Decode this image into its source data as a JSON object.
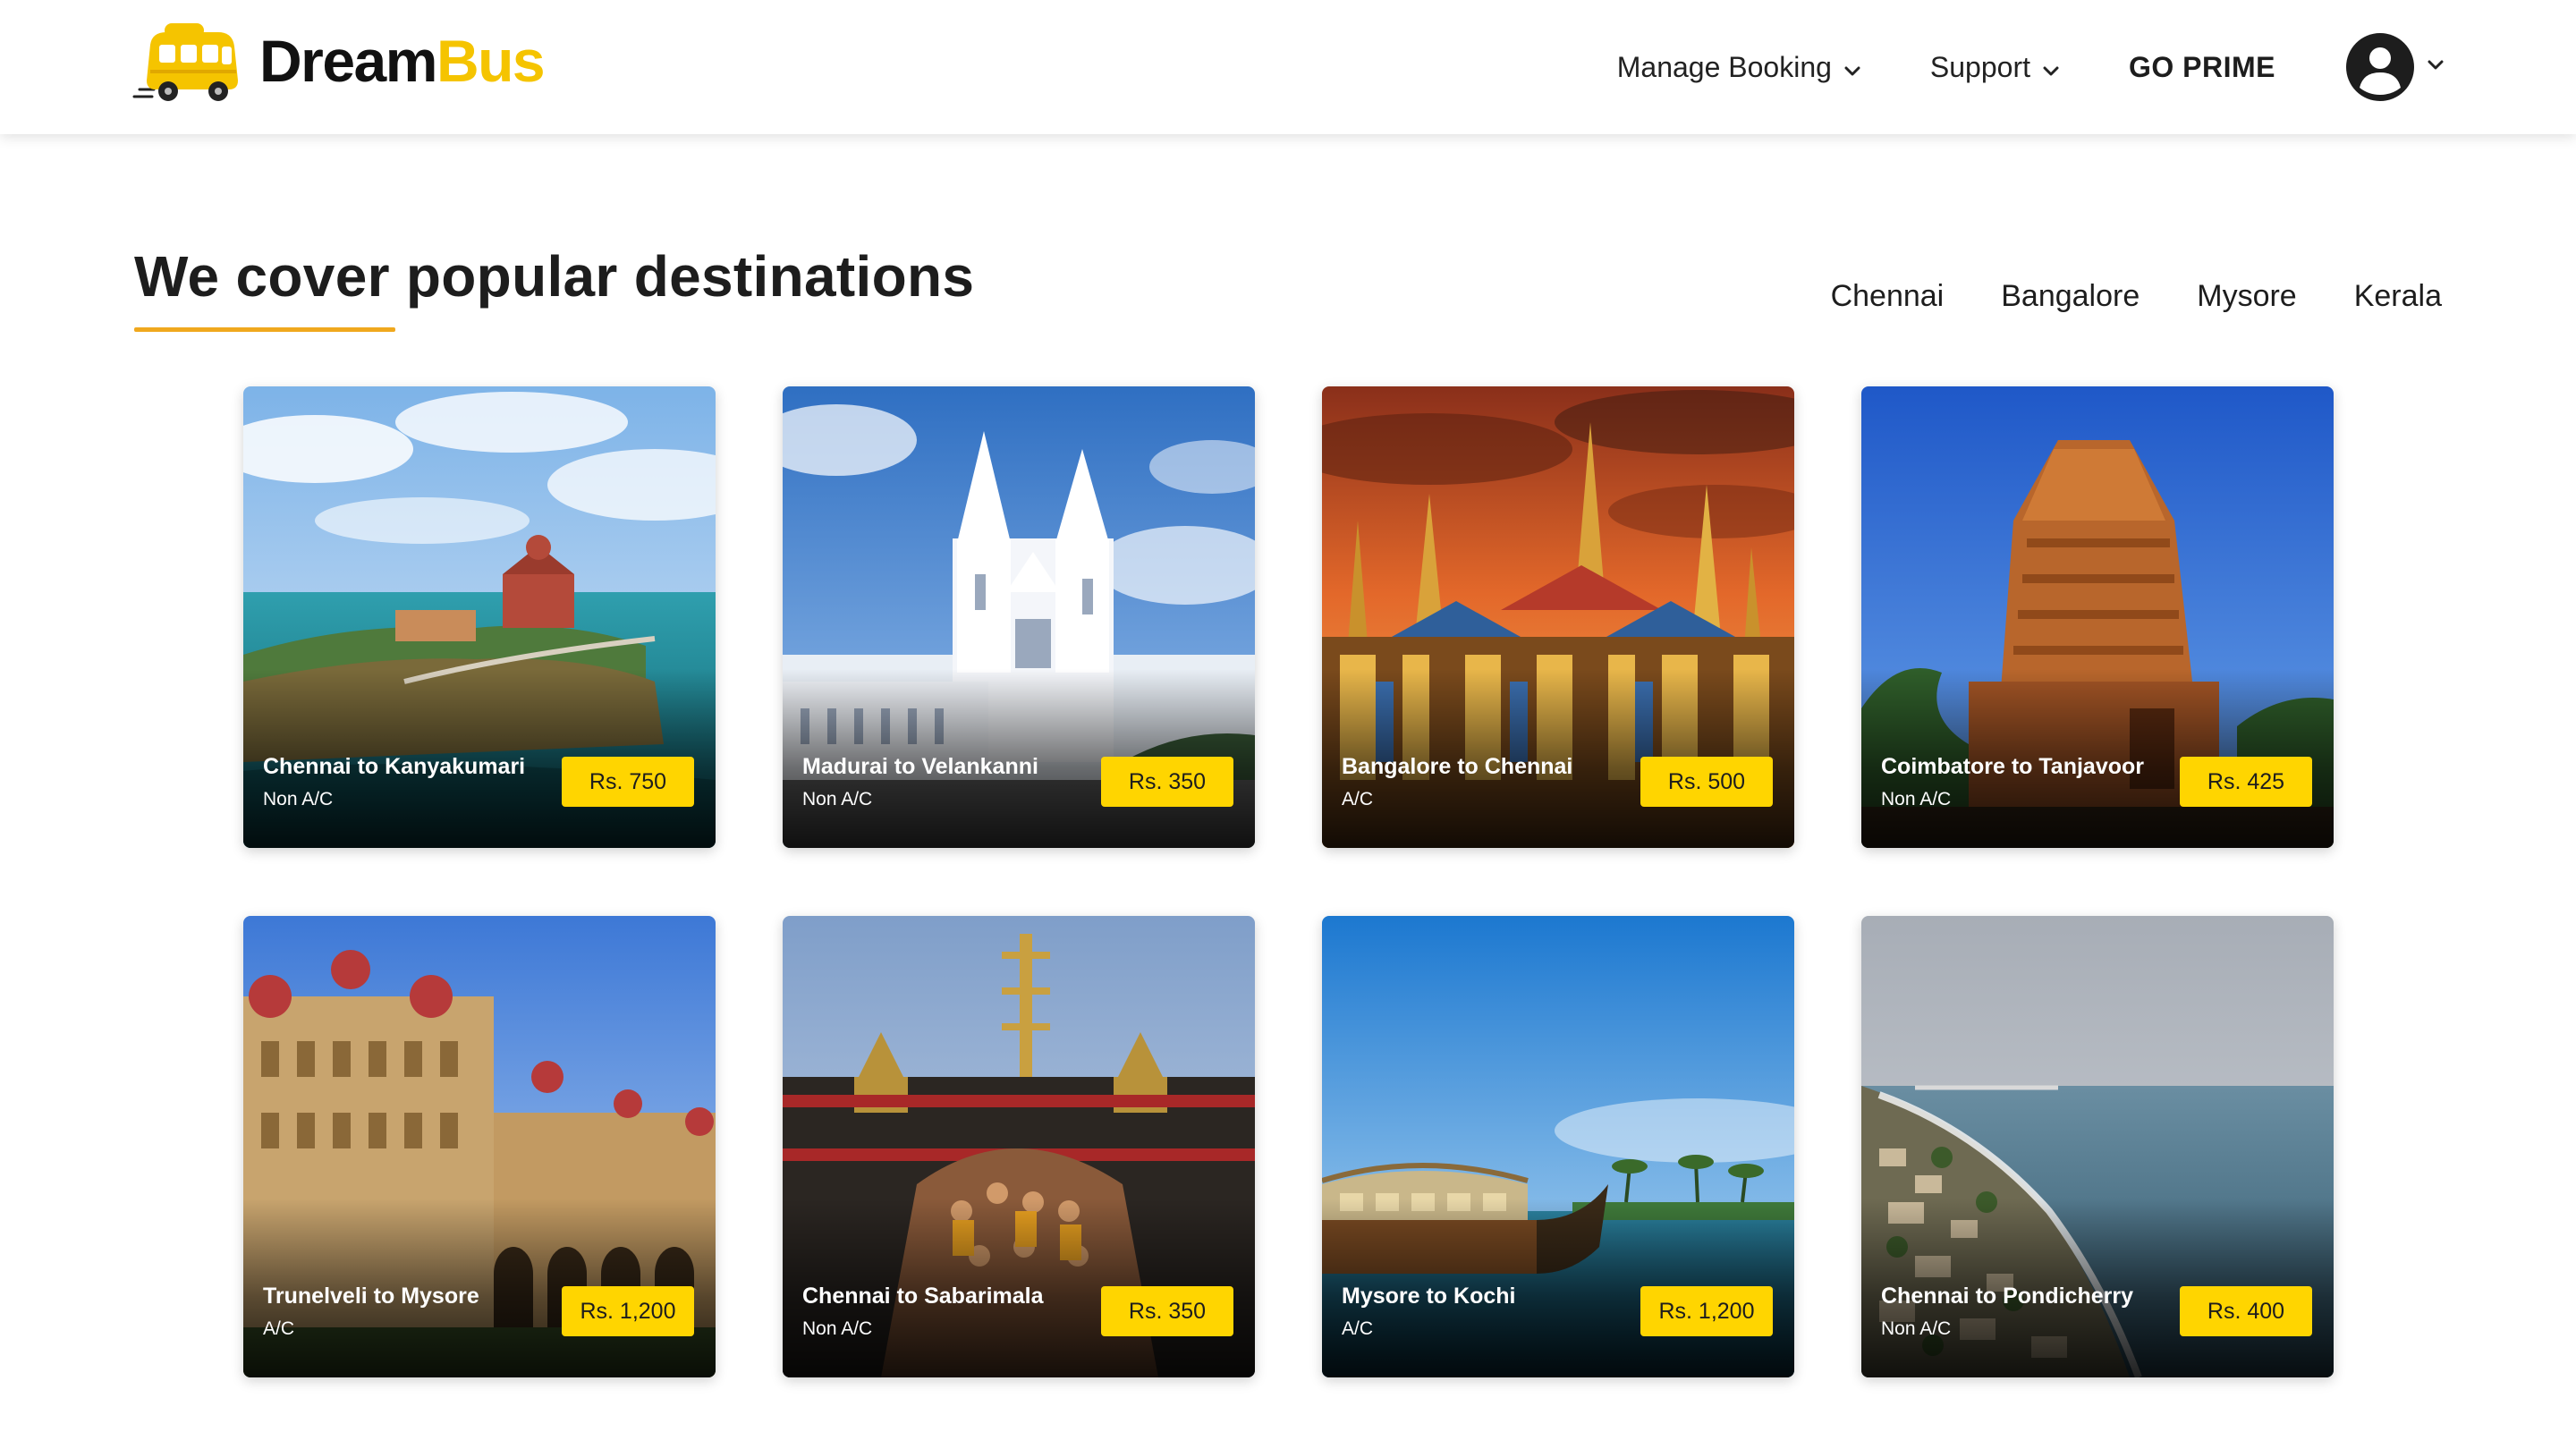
{
  "header": {
    "logo_dream": "Dream",
    "logo_bus": "Bus",
    "nav": {
      "manage_booking": "Manage Booking",
      "support": "Support",
      "go_prime": "GO PRIME"
    }
  },
  "section": {
    "title": "We cover popular destinations",
    "city_tabs": [
      "Chennai",
      "Bangalore",
      "Mysore",
      "Kerala"
    ]
  },
  "cards": [
    {
      "route": "Chennai to Kanyakumari",
      "type": "Non A/C",
      "price": "Rs. 750",
      "scene": "kanyakumari-island-memorial"
    },
    {
      "route": "Madurai to Velankanni",
      "type": "Non A/C",
      "price": "Rs. 350",
      "scene": "velankanni-white-church"
    },
    {
      "route": "Bangalore to Chennai",
      "type": "A/C",
      "price": "Rs. 500",
      "scene": "golden-temple-sunset"
    },
    {
      "route": "Coimbatore to Tanjavoor",
      "type": "Non A/C",
      "price": "Rs. 425",
      "scene": "tanjore-temple-tower"
    },
    {
      "route": "Trunelveli to Mysore",
      "type": "A/C",
      "price": "Rs. 1,200",
      "scene": "mysore-palace"
    },
    {
      "route": "Chennai to Sabarimala",
      "type": "Non A/C",
      "price": "Rs. 350",
      "scene": "sabarimala-temple-crowd"
    },
    {
      "route": "Mysore to Kochi",
      "type": "A/C",
      "price": "Rs. 1,200",
      "scene": "kerala-houseboat"
    },
    {
      "route": "Chennai to Pondicherry",
      "type": "Non A/C",
      "price": "Rs. 400",
      "scene": "pondicherry-coastline"
    }
  ],
  "colors": {
    "brand_yellow": "#f5c400",
    "badge_yellow": "#ffd500",
    "underline_orange": "#f0a81e"
  },
  "icons": {
    "logo": "bus-icon",
    "dropdown": "chevron-down-icon",
    "account": "user-avatar-icon"
  }
}
